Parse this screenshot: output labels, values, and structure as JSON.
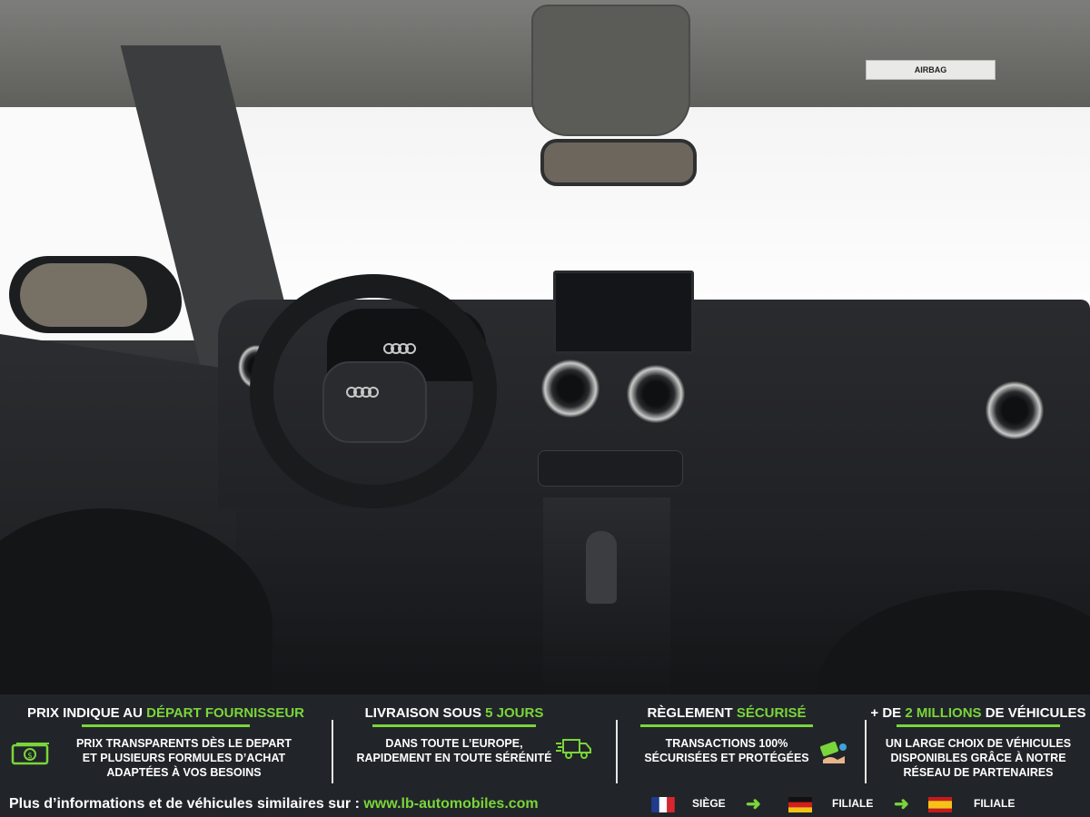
{
  "photo": {
    "airbag_label": "AIRBAG"
  },
  "banner": {
    "columns": [
      {
        "title_pre": "PRIX INDIQUE AU ",
        "title_highlight": "DÉPART FOURNISSEUR",
        "title_post": "",
        "desc_lines": [
          "PRIX TRANSPARENTS DÈS LE DEPART",
          "ET PLUSIEURS FORMULES D’ACHAT",
          "ADAPTÉES À VOS BESOINS"
        ],
        "icon": "money-icon"
      },
      {
        "title_pre": "LIVRAISON SOUS ",
        "title_highlight": "5 JOURS",
        "title_post": "",
        "desc_lines": [
          "DANS TOUTE L’EUROPE,",
          "RAPIDEMENT EN TOUTE SÉRÉNITÉ"
        ],
        "icon": "delivery-truck-icon"
      },
      {
        "title_pre": "RÈGLEMENT ",
        "title_highlight": "SÉCURISÉ",
        "title_post": "",
        "desc_lines": [
          "TRANSACTIONS 100%",
          "SÉCURISÉES ET PROTÉGÉES"
        ],
        "icon": "secure-payment-icon"
      },
      {
        "title_pre": "+ DE ",
        "title_highlight": "2 MILLIONS",
        "title_post": " DE VÉHICULES",
        "desc_lines": [
          "UN LARGE CHOIX DE VÉHICULES",
          "DISPONIBLES GRÂCE À NOTRE",
          "RÉSEAU DE PARTENAIRES"
        ],
        "icon": ""
      }
    ],
    "footer_text": "Plus d’informations et de véhicules similaires sur : ",
    "footer_link": "www.lb-automobiles.com",
    "locations": [
      {
        "flag": "france-flag-icon",
        "label": "SIÈGE"
      },
      {
        "flag": "germany-flag-icon",
        "label": "FILIALE"
      },
      {
        "flag": "spain-flag-icon",
        "label": "FILIALE"
      }
    ],
    "accent_color": "#7ad53a",
    "background_color": "#212529"
  }
}
